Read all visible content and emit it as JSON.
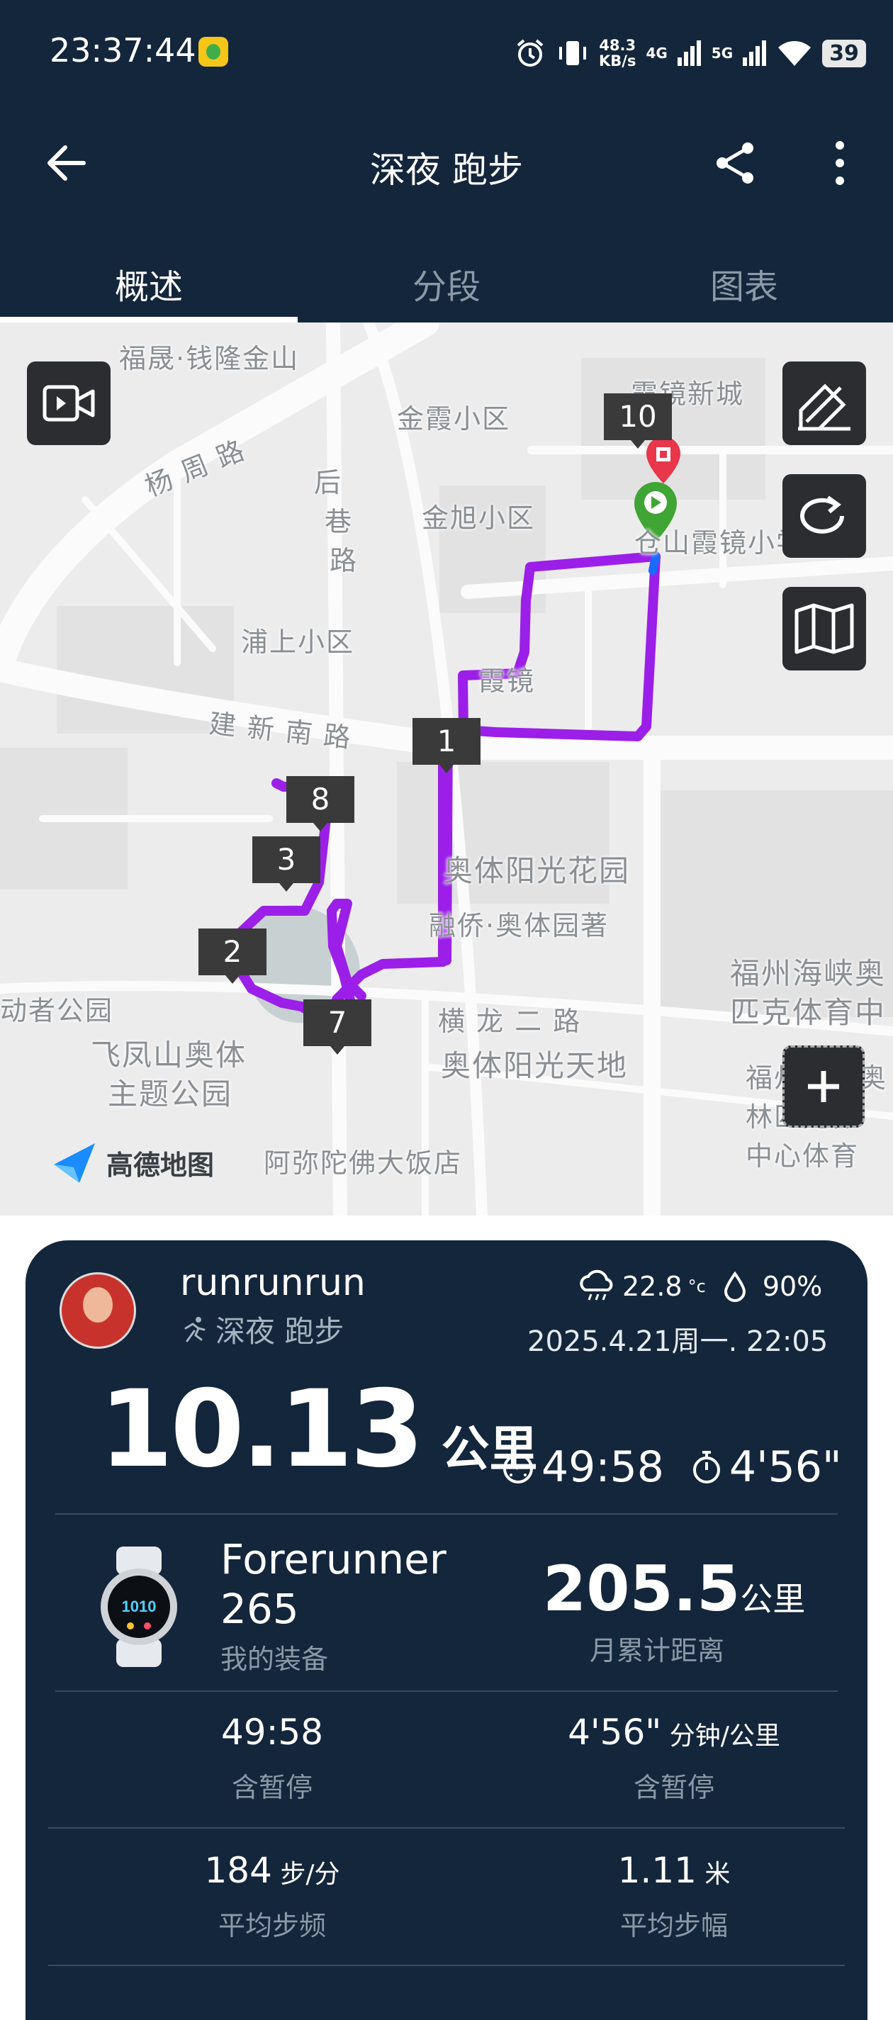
{
  "status_bar": {
    "time": "23:37:44",
    "net_speed_value": "48.3",
    "net_speed_unit": "KB/s",
    "net1": "4G",
    "net2": "5G",
    "battery": "39"
  },
  "header": {
    "title": "深夜 跑步",
    "tabs": [
      {
        "label": "概述",
        "active": true
      },
      {
        "label": "分段",
        "active": false
      },
      {
        "label": "图表",
        "active": false
      }
    ]
  },
  "map": {
    "labels": [
      "福晟·钱隆金山",
      "金霞小区",
      "霞镜新城",
      "杨 周 路",
      "后",
      "巷",
      "路",
      "金旭小区",
      "仓山霞镜小学",
      "浦上小区",
      "霞镜",
      "建 新 南 路",
      "奥体阳光花园",
      "融侨·奥体园著",
      "福州海峡奥",
      "匹克体育中",
      "动者公园",
      "横 龙 二 路",
      "飞凤山奥体",
      "主题公园",
      "奥体阳光天地",
      "福州海峡奥",
      "林匹克体",
      "中心体育",
      "阿弥陀佛大饭店"
    ],
    "markers": [
      "10",
      "1",
      "8",
      "3",
      "2",
      "7"
    ],
    "provider": "高德地图",
    "route_color": "#9b1fe8"
  },
  "summary": {
    "username": "runrunrun",
    "activity": "深夜 跑步",
    "temperature": "22.8",
    "temp_unit": "°c",
    "humidity": "90%",
    "date": "2025.4.21周一. 22:05",
    "distance": "10.13",
    "distance_unit": "公里",
    "duration": "49:58",
    "pace": "4'56\"",
    "device_line1": "Forerunner",
    "device_line2": "265",
    "device_label": "我的装备",
    "month_distance": "205.5",
    "month_unit": "公里",
    "month_label": "月累计距离",
    "stats": [
      {
        "value": "49:58",
        "unit": "",
        "label": "含暂停"
      },
      {
        "value": "4'56\"",
        "unit": " 分钟/公里",
        "label": "含暂停"
      },
      {
        "value": "184",
        "unit": " 步/分",
        "label": "平均步频"
      },
      {
        "value": "1.11",
        "unit": " 米",
        "label": "平均步幅"
      }
    ]
  }
}
